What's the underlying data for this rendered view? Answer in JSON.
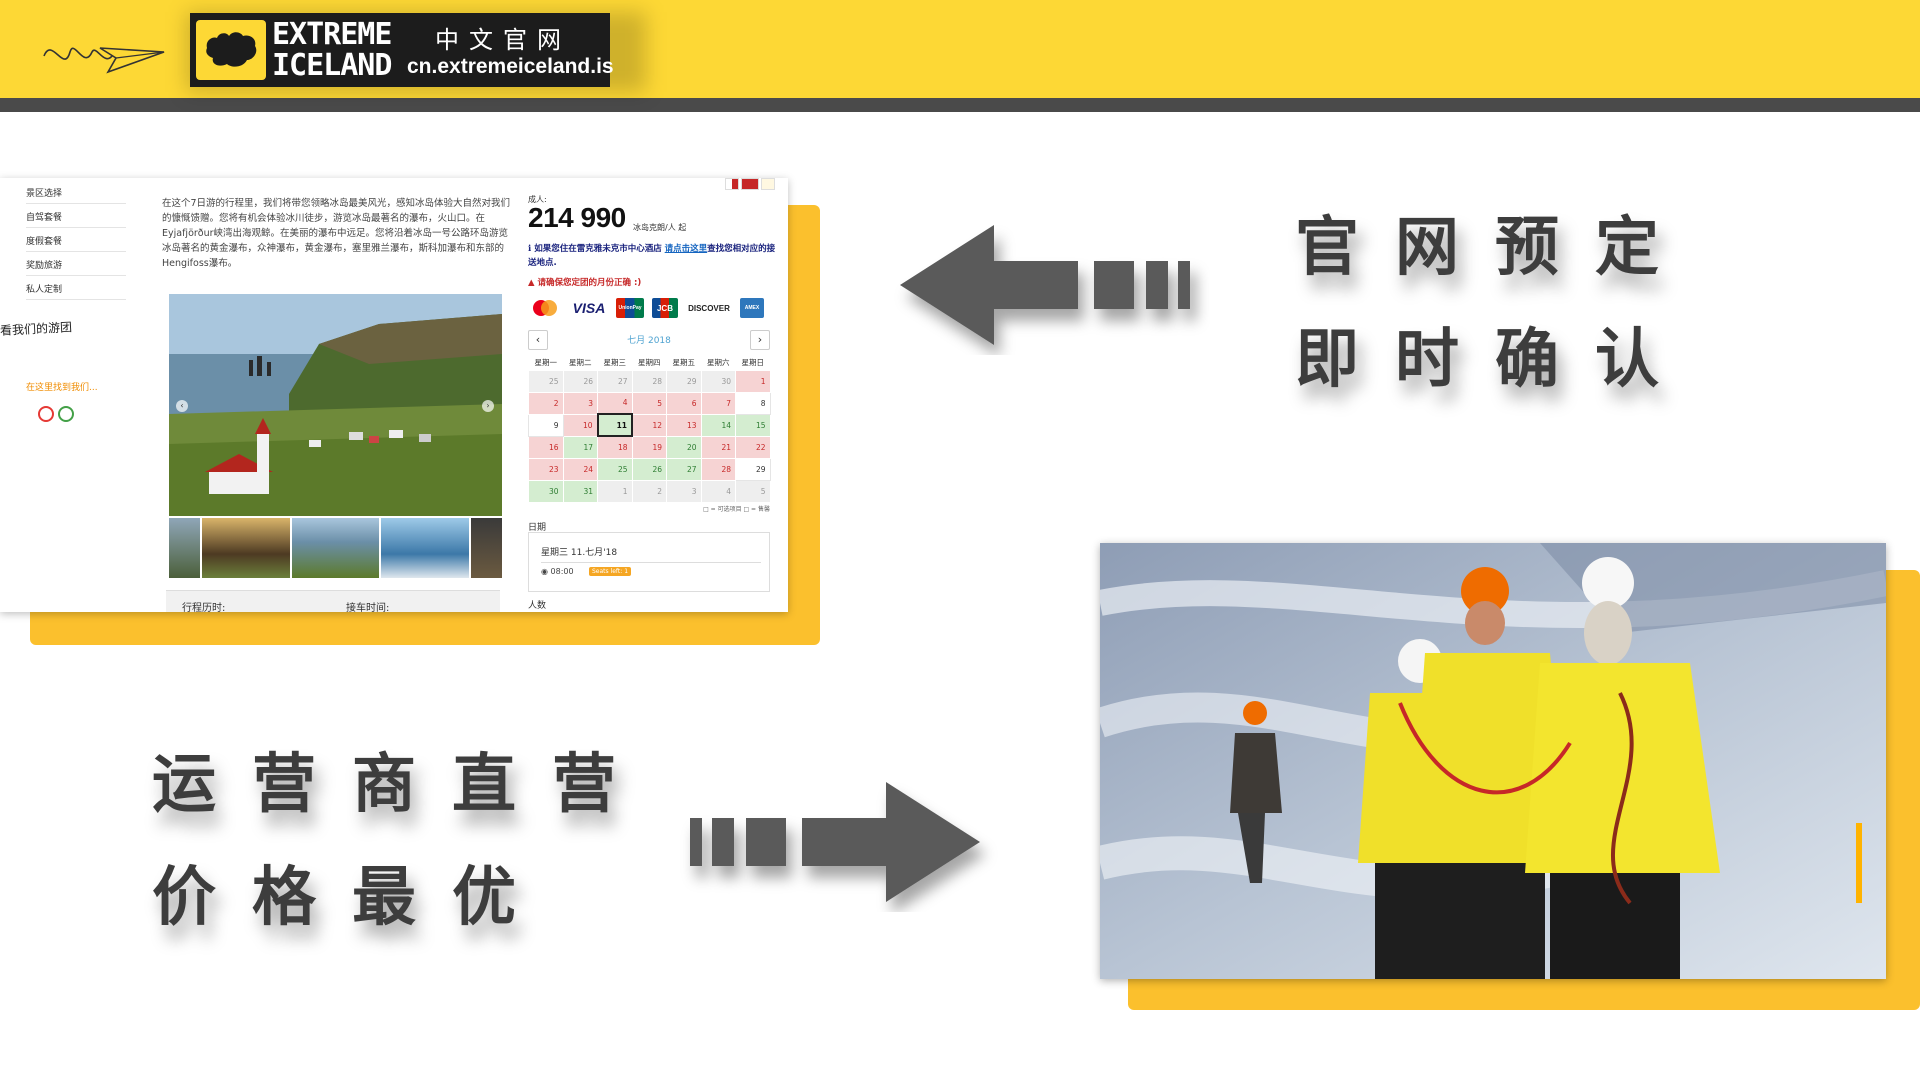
{
  "header": {
    "logo_line1": "EXTREME",
    "logo_line2": "ICELAND",
    "logo_cn": "中文官网",
    "url": "cn.extremeiceland.is"
  },
  "website": {
    "nav": [
      "景区选择",
      "自驾套餐",
      "度假套餐",
      "奖励旅游",
      "私人定制"
    ],
    "sidebar_title": "看我们的游团",
    "sidebar_link": "在这里找到我们...",
    "description": "在这个7日游的行程里，我们将带您领略冰岛最美风光，感知冰岛体验大自然对我们的慷慨馈赠。您将有机会体验冰川徒步，游览冰岛最著名的瀑布，火山口。在Eyjafjörður峡湾出海观鲸。在美丽的瀑布中远足。您将沿着冰岛一号公路环岛游览冰岛著名的黄金瀑布，众神瀑布，黄金瀑布，塞里雅兰瀑布，斯科加瀑布和东部的Hengifoss瀑布。",
    "info_left": "行程历时:",
    "info_right": "接车时间:",
    "booking": {
      "adult_label": "成人:",
      "price": "214 990",
      "price_unit": "冰岛克朗/人 起",
      "notice_text": "ℹ 如果您住在雷克雅未克市中心酒店 ",
      "notice_link": "请点击这里",
      "notice_tail": "查找您相对应的接送地点.",
      "warning": "▲ 请确保您定团的月份正确 :)",
      "cards": [
        "mastercard-icon",
        "VISA",
        "UnionPay",
        "JCB",
        "DISCOVER",
        "AMEX"
      ],
      "month": "七月 2018",
      "weekdays": [
        "星期一",
        "星期二",
        "星期三",
        "星期四",
        "星期五",
        "星期六",
        "星期日"
      ],
      "weeks": [
        [
          "25",
          "26",
          "27",
          "28",
          "29",
          "30",
          "1"
        ],
        [
          "2",
          "3",
          "4",
          "5",
          "6",
          "7",
          "8"
        ],
        [
          "9",
          "10",
          "11",
          "12",
          "13",
          "14",
          "15"
        ],
        [
          "16",
          "17",
          "18",
          "19",
          "20",
          "21",
          "22"
        ],
        [
          "23",
          "24",
          "25",
          "26",
          "27",
          "28",
          "29"
        ],
        [
          "30",
          "31",
          "1",
          "2",
          "3",
          "4",
          "5"
        ]
      ],
      "legend": "□ = 可选项目 □ = 售馨",
      "date_label": "日期",
      "selected_date": "星期三 11.七月'18",
      "slot_time": "08:00",
      "seats_left": "Seats left: 1",
      "people_label": "人数"
    }
  },
  "taglines": {
    "line1": "官网预定",
    "line2": "即时确认",
    "line3": "运营商直营",
    "line4": "价格最优"
  },
  "colors": {
    "header_yellow": "#fdd835",
    "accent_yellow": "#fbc02d",
    "dark_bar": "#4a4a4a",
    "arrow_gray": "#5a5a5a"
  }
}
